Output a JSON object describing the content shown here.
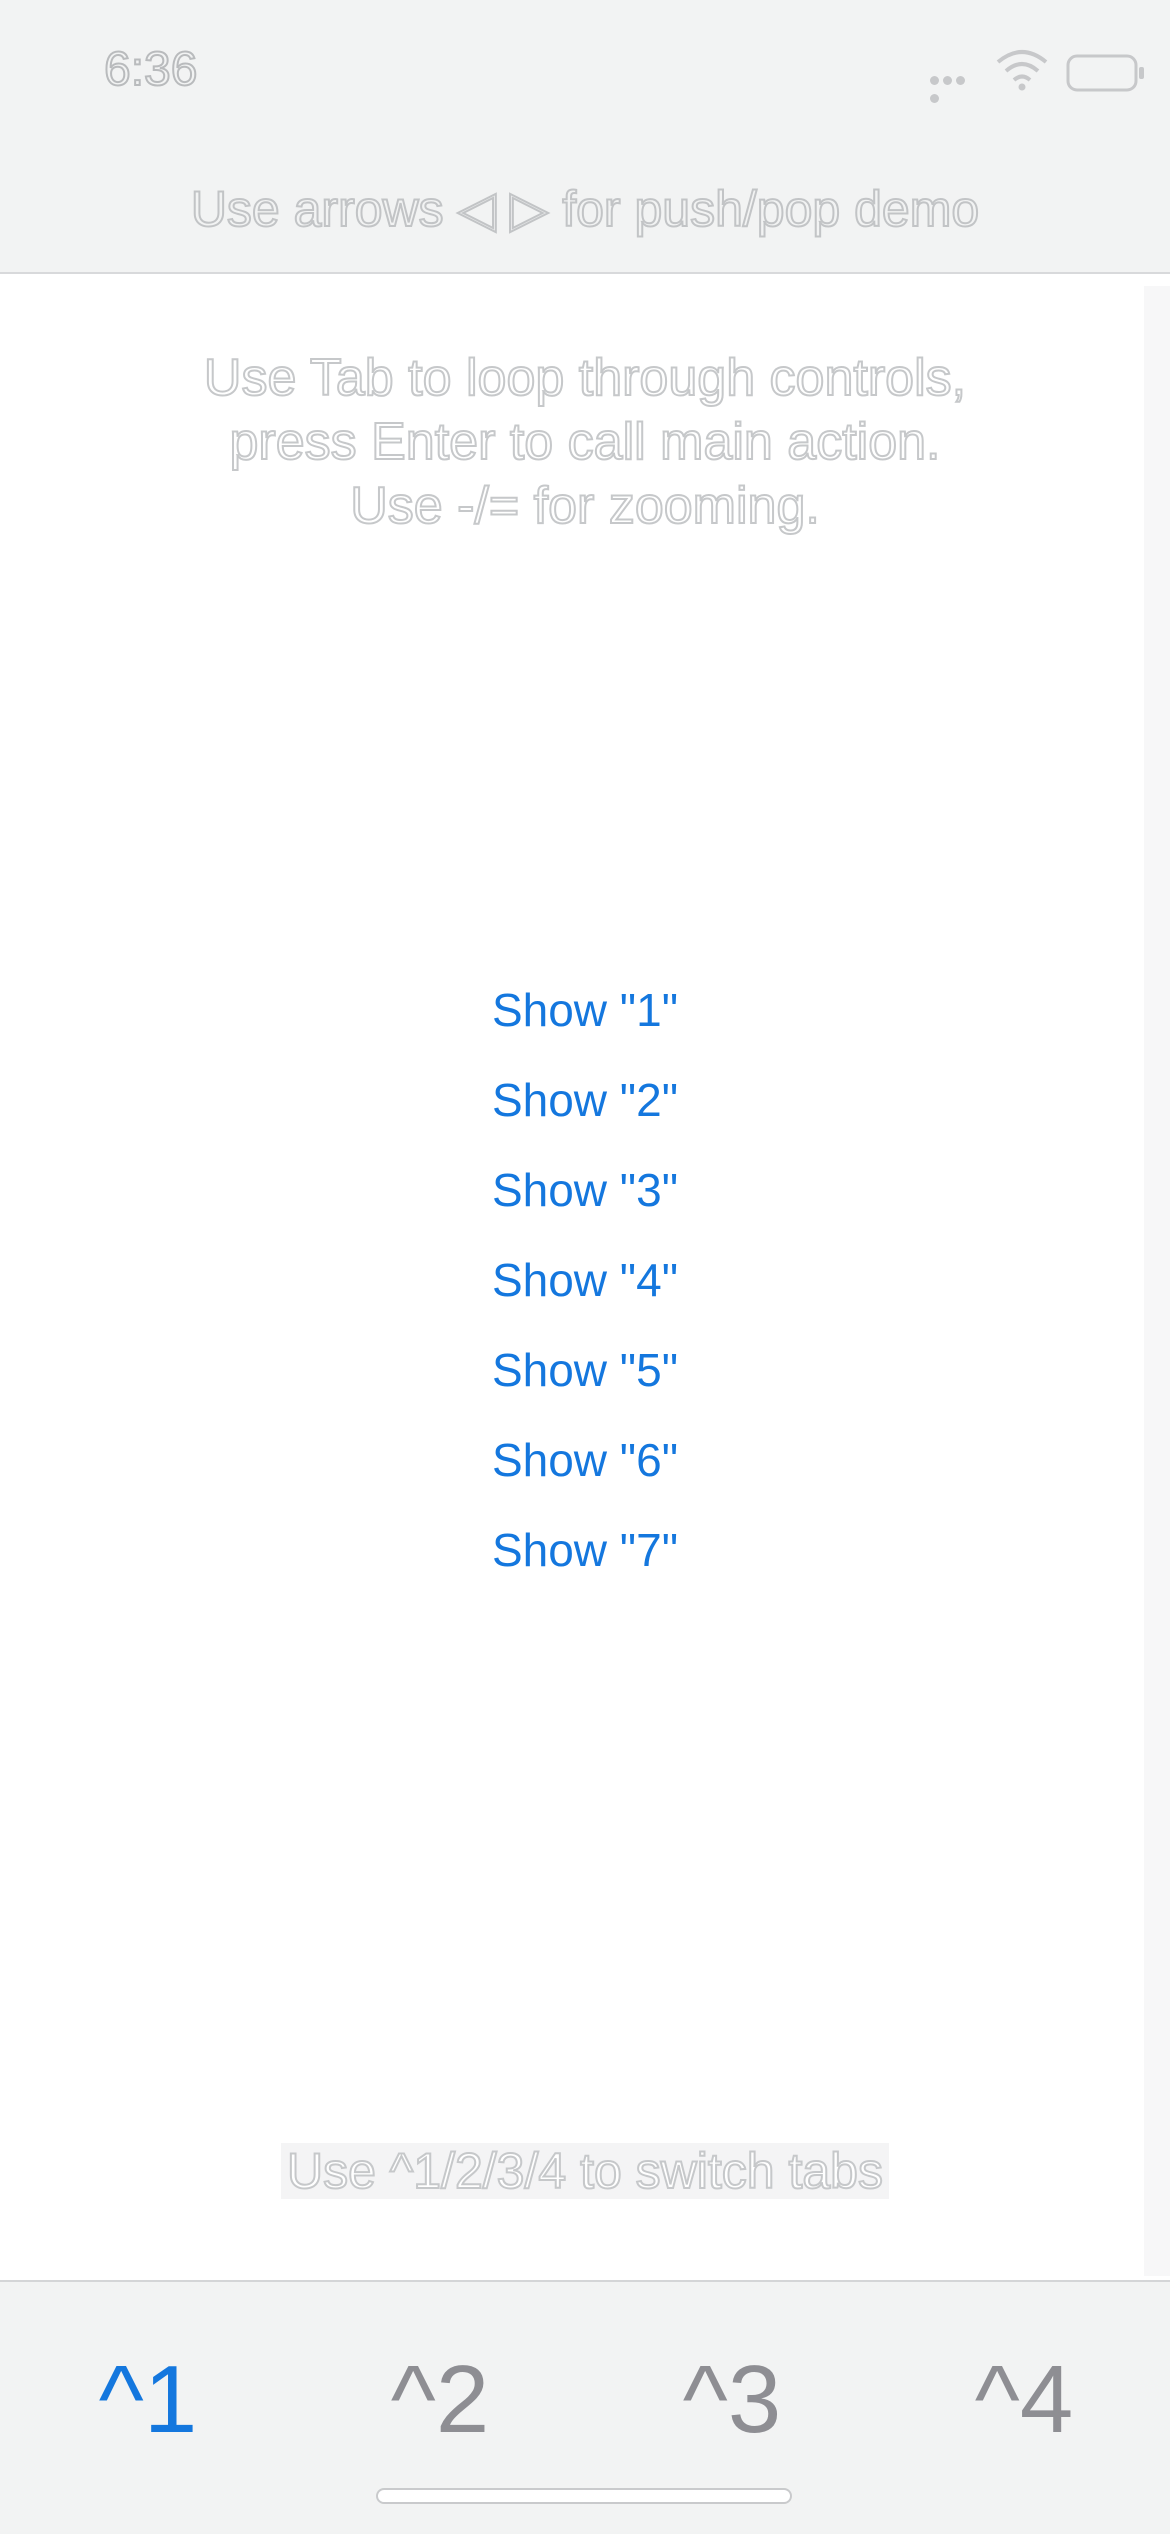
{
  "status_bar": {
    "time": "6:36",
    "icons": [
      "signal-icon",
      "wifi-icon",
      "battery-icon"
    ]
  },
  "nav": {
    "title": "Use arrows ◁ ▷ for push/pop demo"
  },
  "content": {
    "hint_lines": [
      "Use Tab to loop through controls,",
      "press Enter to call main action.",
      "Use -/= for zooming."
    ],
    "buttons": [
      "Show \"1\"",
      "Show \"2\"",
      "Show \"3\"",
      "Show \"4\"",
      "Show \"5\"",
      "Show \"6\"",
      "Show \"7\""
    ],
    "footer_hint": "Use ^1/2/3/4 to switch tabs"
  },
  "tab_bar": {
    "tabs": [
      "^1",
      "^2",
      "^3",
      "^4"
    ],
    "active_index": 0
  },
  "colors": {
    "accent": "#1477de",
    "inactive_tab": "#8e8e93",
    "bar_background": "#f2f3f3"
  }
}
